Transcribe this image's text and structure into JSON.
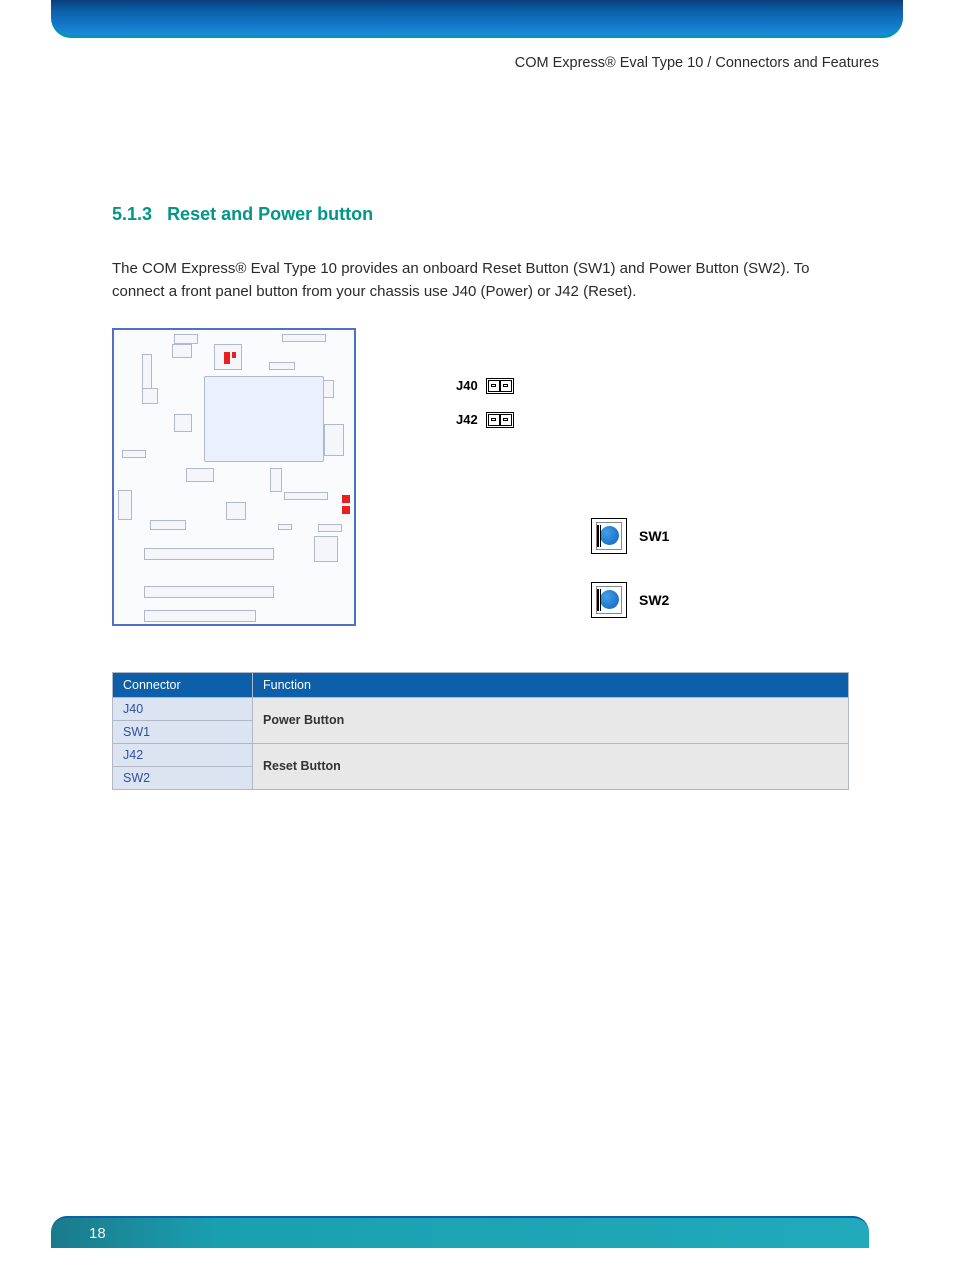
{
  "header": {
    "breadcrumb": "COM Express® Eval Type 10 / Connectors and Features"
  },
  "section": {
    "number": "5.1.3",
    "title": "Reset and Power button",
    "body": "The COM Express® Eval Type 10 provides an onboard Reset Button (SW1) and Power Button (SW2). To connect a front panel button from your chassis use J40 (Power) or J42 (Reset)."
  },
  "labels": {
    "j40": "J40",
    "j42": "J42",
    "sw1": "SW1",
    "sw2": "SW2"
  },
  "table": {
    "headers": {
      "connector": "Connector",
      "function": "Function"
    },
    "rows": [
      {
        "connector": "J40",
        "function": "Power Button"
      },
      {
        "connector": "SW1",
        "function": ""
      },
      {
        "connector": "J42",
        "function": "Reset Button"
      },
      {
        "connector": "SW2",
        "function": ""
      }
    ]
  },
  "footer": {
    "page": "18"
  }
}
